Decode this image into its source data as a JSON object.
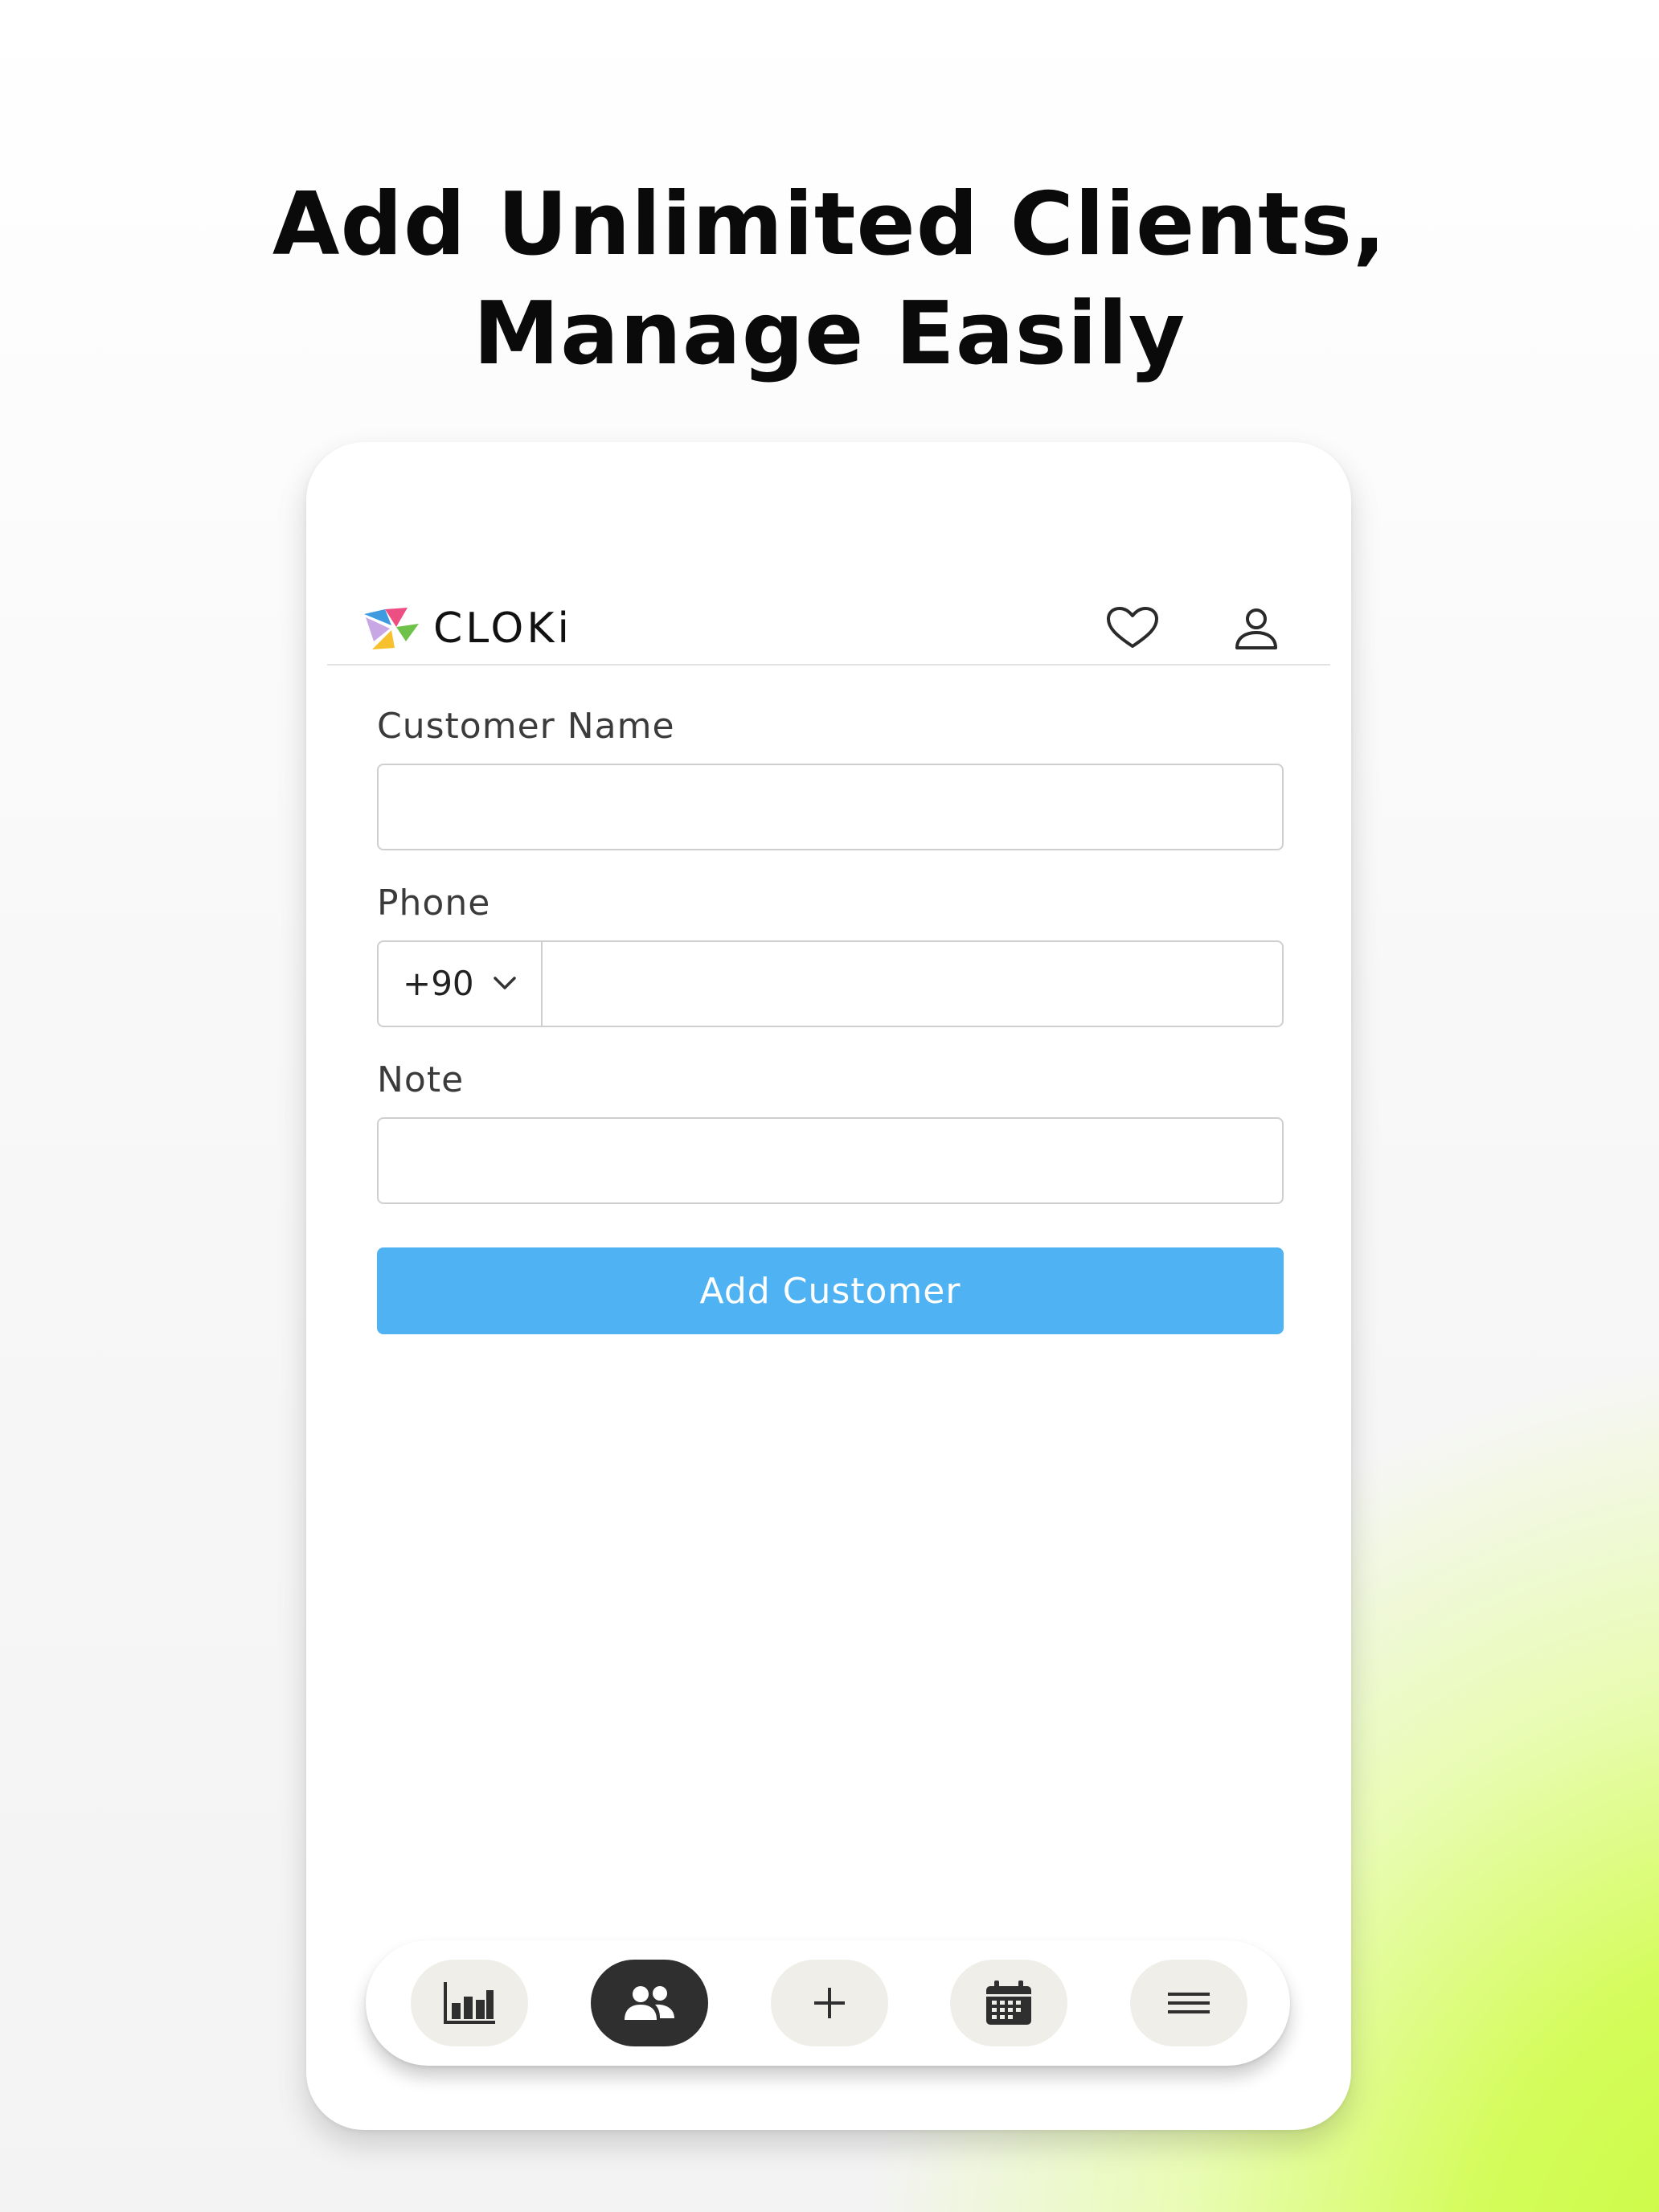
{
  "headline": {
    "line1": "Add Unlimited Clients,",
    "line2": "Manage Easily"
  },
  "app": {
    "brand": "CLOKi",
    "header_icons": [
      "heart-icon",
      "user-icon"
    ]
  },
  "form": {
    "customer_name_label": "Customer Name",
    "customer_name_value": "",
    "phone_label": "Phone",
    "country_code": "+90",
    "phone_value": "",
    "note_label": "Note",
    "note_value": "",
    "submit_label": "Add Customer"
  },
  "bottom_nav": {
    "items": [
      {
        "icon": "bar-chart-icon",
        "active": false
      },
      {
        "icon": "users-icon",
        "active": true
      },
      {
        "icon": "plus-icon",
        "active": false
      },
      {
        "icon": "calendar-icon",
        "active": false
      },
      {
        "icon": "menu-icon",
        "active": false
      }
    ]
  },
  "colors": {
    "accent_button": "#4fb2f2",
    "active_nav": "#2f2f2f",
    "inactive_nav": "#f0eee9",
    "background_glow": "#c7fa3c"
  }
}
